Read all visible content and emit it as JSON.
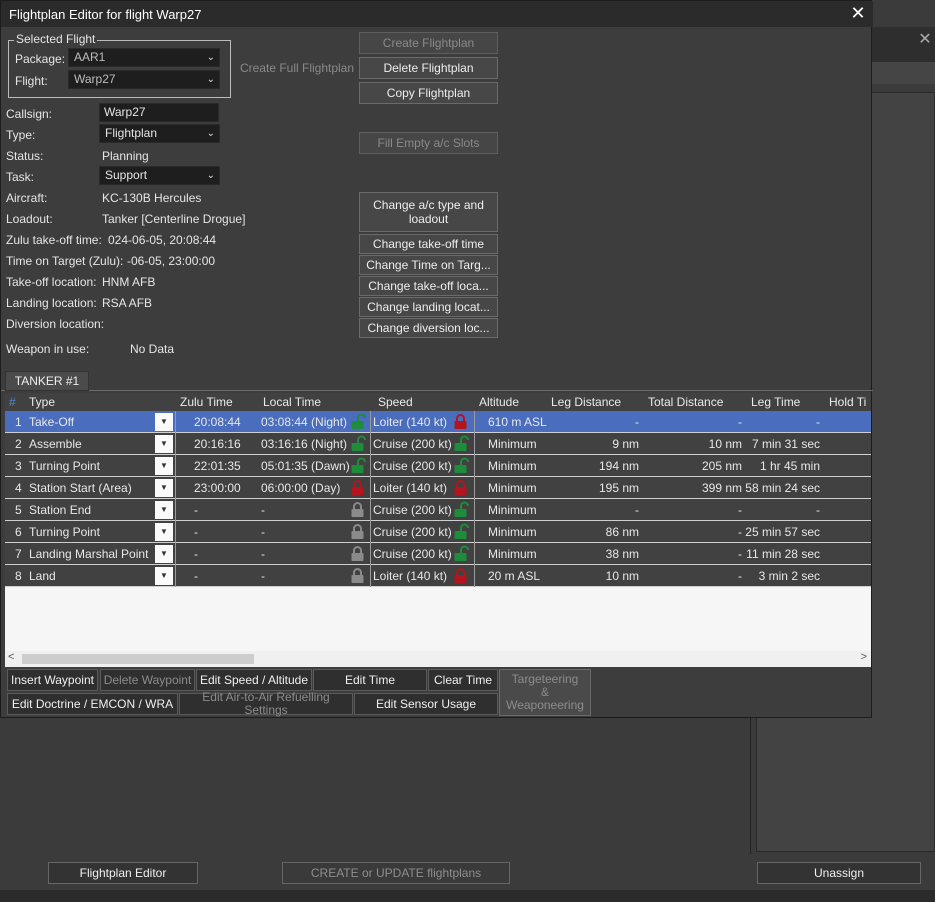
{
  "window": {
    "title": "Flightplan Editor for flight Warp27"
  },
  "selected_flight": {
    "legend": "Selected Flight",
    "package_label": "Package:",
    "package_value": "AAR1",
    "flight_label": "Flight:",
    "flight_value": "Warp27"
  },
  "buttons": {
    "create_full": "Create Full Flightplan",
    "create": "Create Flightplan",
    "delete": "Delete Flightplan",
    "copy": "Copy Flightplan",
    "fill_empty": "Fill Empty a/c Slots",
    "change_ac": "Change a/c type and loadout",
    "change_takeoff_time": "Change take-off time",
    "change_tot": "Change Time on Targ...",
    "change_takeoff_loc": "Change take-off loca...",
    "change_landing_loc": "Change landing locat...",
    "change_diversion_loc": "Change diversion loc..."
  },
  "info": {
    "callsign_label": "Callsign:",
    "callsign_value": "Warp27",
    "type_label": "Type:",
    "type_value": "Flightplan",
    "status_label": "Status:",
    "status_value": "Planning",
    "task_label": "Task:",
    "task_value": "Support",
    "aircraft_label": "Aircraft:",
    "aircraft_value": "KC-130B Hercules",
    "loadout_label": "Loadout:",
    "loadout_value": "Tanker [Centerline Drogue]",
    "zulu_takeoff_label": "Zulu take-off time:",
    "zulu_takeoff_value": "024-06-05, 20:08:44",
    "tot_label": "Time on Target (Zulu):",
    "tot_value": "-06-05, 23:00:00",
    "takeoff_loc_label": "Take-off location:",
    "takeoff_loc_value": "HNM AFB",
    "landing_loc_label": "Landing location:",
    "landing_loc_value": "RSA AFB",
    "diversion_label": "Diversion location:",
    "weapon_label": "Weapon in use:",
    "weapon_value": "No Data"
  },
  "tab": {
    "label": "TANKER #1"
  },
  "table": {
    "columns": [
      "#",
      "Type",
      "Zulu Time",
      "Local Time",
      "Speed",
      "Altitude",
      "Leg Distance",
      "Total Distance",
      "Leg Time",
      "Hold Ti"
    ],
    "rows": [
      {
        "n": "1",
        "type": "Take-Off",
        "zulu": "20:08:44",
        "local": "03:08:44 (Night)",
        "lock1": "green-open",
        "speed": "Loiter (140 kt)",
        "lock2": "red",
        "alt": "610 m ASL",
        "leg": "-",
        "total": "-",
        "legtime": "-"
      },
      {
        "n": "2",
        "type": "Assemble",
        "zulu": "20:16:16",
        "local": "03:16:16 (Night)",
        "lock1": "green-open",
        "speed": "Cruise (200 kt)",
        "lock2": "green-open",
        "alt": "Minimum",
        "leg": "9 nm",
        "total": "10 nm",
        "legtime": "7 min 31 sec"
      },
      {
        "n": "3",
        "type": "Turning Point",
        "zulu": "22:01:35",
        "local": "05:01:35 (Dawn)",
        "lock1": "green-open",
        "speed": "Cruise (200 kt)",
        "lock2": "green-open",
        "alt": "Minimum",
        "leg": "194 nm",
        "total": "205 nm",
        "legtime": "1 hr 45 min"
      },
      {
        "n": "4",
        "type": "Station Start (Area)",
        "zulu": "23:00:00",
        "local": "06:00:00 (Day)",
        "lock1": "red",
        "speed": "Loiter (140 kt)",
        "lock2": "red",
        "alt": "Minimum",
        "leg": "195 nm",
        "total": "399 nm",
        "legtime": "58 min 24 sec"
      },
      {
        "n": "5",
        "type": "Station End",
        "zulu": "-",
        "local": "-",
        "lock1": "gray",
        "speed": "Cruise (200 kt)",
        "lock2": "green-open",
        "alt": "Minimum",
        "leg": "-",
        "total": "-",
        "legtime": "-"
      },
      {
        "n": "6",
        "type": "Turning Point",
        "zulu": "-",
        "local": "-",
        "lock1": "gray",
        "speed": "Cruise (200 kt)",
        "lock2": "green-open",
        "alt": "Minimum",
        "leg": "86 nm",
        "total": "-",
        "legtime": "25 min 57 sec"
      },
      {
        "n": "7",
        "type": "Landing Marshal Point",
        "zulu": "-",
        "local": "-",
        "lock1": "gray",
        "speed": "Cruise (200 kt)",
        "lock2": "green-open",
        "alt": "Minimum",
        "leg": "38 nm",
        "total": "-",
        "legtime": "11 min 28 sec"
      },
      {
        "n": "8",
        "type": "Land",
        "zulu": "-",
        "local": "-",
        "lock1": "gray",
        "speed": "Loiter (140 kt)",
        "lock2": "red",
        "alt": "20 m ASL",
        "leg": "10 nm",
        "total": "-",
        "legtime": "3 min 2 sec"
      }
    ]
  },
  "toolbar": {
    "insert_waypoint": "Insert Waypoint",
    "delete_waypoint": "Delete Waypoint",
    "edit_speed_alt": "Edit Speed / Altitude",
    "edit_time": "Edit Time",
    "clear_time": "Clear Time",
    "targeteering": "Targeteering & Weaponeering",
    "edit_doctrine": "Edit Doctrine / EMCON / WRA",
    "edit_refuel": "Edit Air-to-Air Refuelling Settings",
    "edit_sensor": "Edit Sensor Usage"
  },
  "footer": {
    "flightplan_editor": "Flightplan Editor",
    "create_update": "CREATE or UPDATE flightplans",
    "unassign": "Unassign"
  },
  "colors": {
    "selected_row": "#4a6dbd",
    "lock_green": "#1e8c3a",
    "lock_red": "#b3141d",
    "lock_gray": "#8a8a8a"
  }
}
